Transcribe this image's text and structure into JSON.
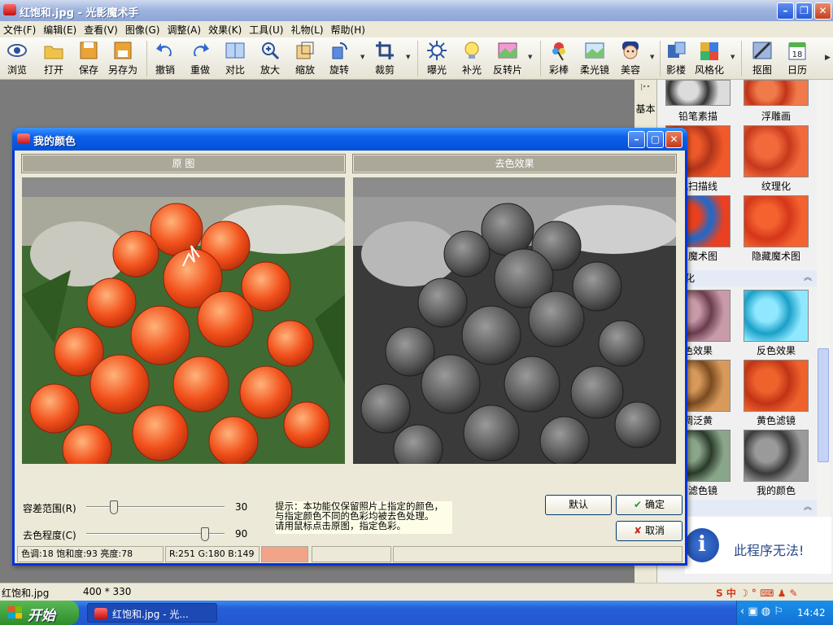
{
  "window": {
    "title": "红饱和.jpg - 光影魔术手"
  },
  "menu": [
    "文件(F)",
    "编辑(E)",
    "查看(V)",
    "图像(G)",
    "调整(A)",
    "效果(K)",
    "工具(U)",
    "礼物(L)",
    "帮助(H)"
  ],
  "toolbar": {
    "browse": "浏览",
    "open": "打开",
    "save": "保存",
    "save_as": "另存为",
    "undo": "撤销",
    "redo": "重做",
    "compare": "对比",
    "zoom_in": "放大",
    "scale": "缩放",
    "rotate": "旋转",
    "crop": "裁剪",
    "exposure": "曝光",
    "fill_light": "补光",
    "reversal": "反转片",
    "color_stick": "彩棒",
    "soft_light": "柔光镜",
    "beauty": "美容",
    "shadow": "影楼",
    "stylize": "风格化",
    "cutout": "抠图",
    "calendar": "日历",
    "calendar_num": "18"
  },
  "right_panel": {
    "tab_label": "基本",
    "effects": [
      "铅笔素描",
      "浮雕画",
      "视扫描线",
      "纹理化",
      "白魔术图",
      "隐藏魔术图",
      "色效果",
      "反色效果",
      "调泛黄",
      "黄色滤镜",
      "字滤色镜",
      "我的颜色"
    ],
    "category_label": "变化",
    "info_message": "此程序无法!"
  },
  "statusbar": {
    "filename": "红饱和.jpg",
    "size": "400 * 330"
  },
  "taskbar": {
    "start": "开始",
    "task_item": "红饱和.jpg - 光...",
    "clock": "14:42"
  },
  "dialog": {
    "title": "我的颜色",
    "original_header": "原  图",
    "effect_header": "去色效果",
    "tolerance_label": "容差范围(R)",
    "tolerance_value": "30",
    "tolerance_fraction": 0.18,
    "desat_label": "去色程度(C)",
    "desat_value": "90",
    "desat_fraction": 0.88,
    "hint": "提示：本功能仅保留照片上指定的颜色，\n与指定颜色不同的色彩均被去色处理。\n请用鼠标点击原图，指定色彩。",
    "btn_default": "默认",
    "btn_ok": "确定",
    "btn_cancel": "取消",
    "status_hsb": "色调:18 饱和度:93 亮度:78",
    "status_rgb": "R:251 G:180 B:149",
    "picked_color": "#f2a48a"
  }
}
